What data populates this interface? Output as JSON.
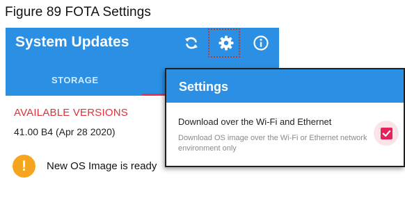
{
  "caption": "Figure 89 FOTA Settings",
  "app": {
    "title": "System Updates",
    "icons": {
      "refresh": "refresh-icon",
      "settings": "gear-icon",
      "info": "info-icon"
    },
    "tabs": [
      "STORAGE"
    ],
    "section_title": "AVAILABLE VERSIONS",
    "version": "41.00 B4 (Apr 28 2020)",
    "notice": {
      "icon": "warning-icon",
      "text": "New OS Image is ready"
    }
  },
  "settings_dialog": {
    "title": "Settings",
    "option": {
      "title": "Download over the Wi-Fi and Ethernet",
      "description": "Download OS image over the Wi-Fi or Ethernet network environment only",
      "checked": true
    }
  },
  "colors": {
    "app_bar": "#2b8fe3",
    "accent_red": "#e0303a",
    "checkbox": "#e5235a",
    "warning": "#f6a51f",
    "highlight_box": "#c0392b"
  }
}
